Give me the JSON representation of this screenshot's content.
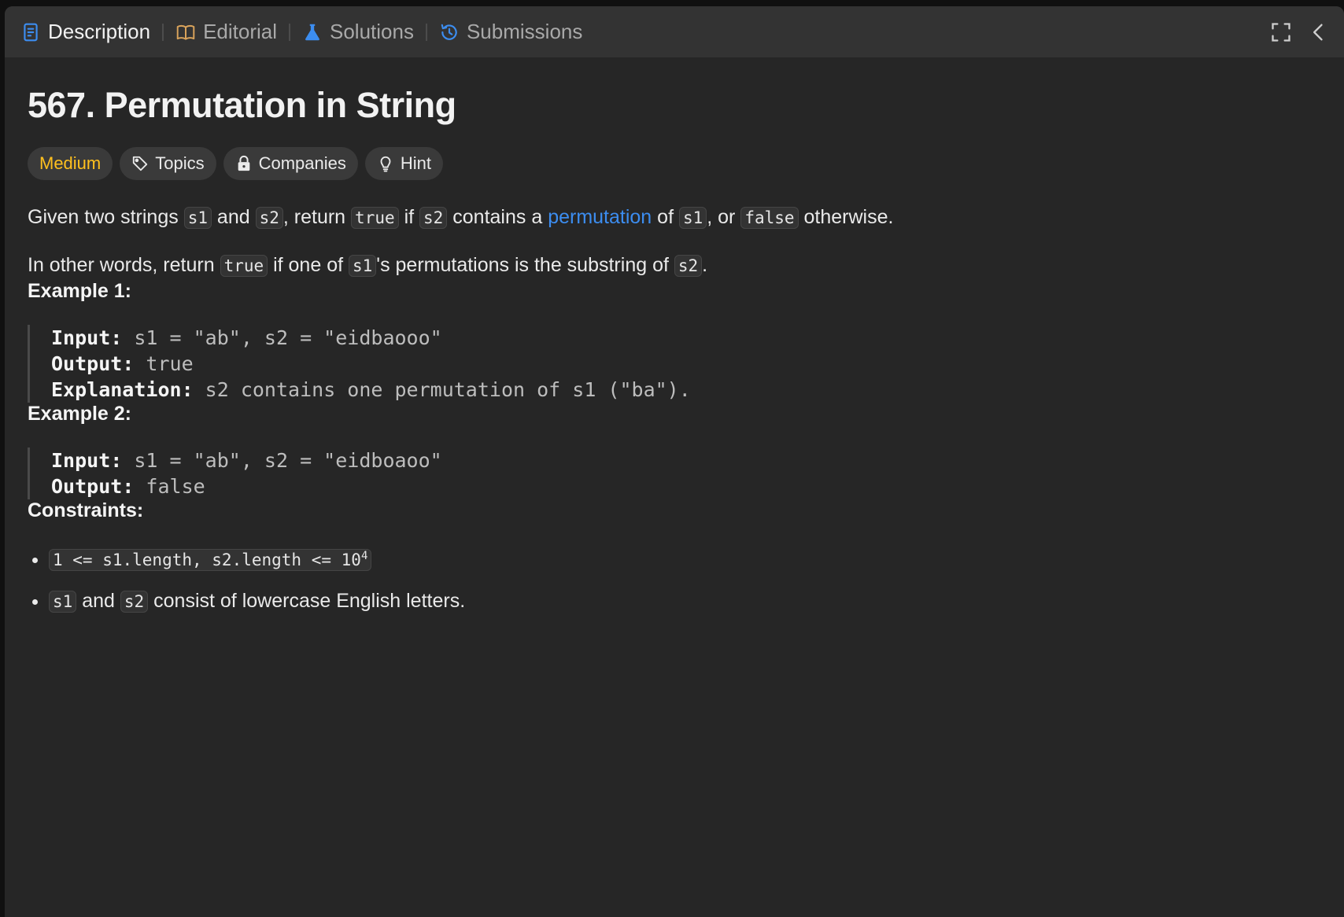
{
  "tabs": {
    "description": "Description",
    "editorial": "Editorial",
    "solutions": "Solutions",
    "submissions": "Submissions"
  },
  "problem": {
    "title": "567. Permutation in String",
    "tags": {
      "difficulty": "Medium",
      "topics": "Topics",
      "companies": "Companies",
      "hint": "Hint"
    }
  },
  "statement": {
    "p1": {
      "t1": "Given two strings ",
      "c1": "s1",
      "t2": " and ",
      "c2": "s2",
      "t3": ", return ",
      "c3": "true",
      "t4": " if ",
      "c4": "s2",
      "t5": " contains a ",
      "link": "permutation",
      "t6": " of ",
      "c5": "s1",
      "t7": ", or ",
      "c6": "false",
      "t8": " otherwise."
    },
    "p2": {
      "t1": "In other words, return ",
      "c1": "true",
      "t2": " if one of ",
      "c2": "s1",
      "t3": "'s permutations is the substring of ",
      "c3": "s2",
      "t4": "."
    }
  },
  "examples": [
    {
      "heading": "Example 1:",
      "input_label": "Input:",
      "input_value": " s1 = \"ab\", s2 = \"eidbaooo\"",
      "output_label": "Output:",
      "output_value": " true",
      "explanation_label": "Explanation:",
      "explanation_value": " s2 contains one permutation of s1 (\"ba\")."
    },
    {
      "heading": "Example 2:",
      "input_label": "Input:",
      "input_value": " s1 = \"ab\", s2 = \"eidboaoo\"",
      "output_label": "Output:",
      "output_value": " false"
    }
  ],
  "constraints": {
    "heading": "Constraints:",
    "c1_code": "1 <= s1.length, s2.length <= 10",
    "c1_exp": "4",
    "c2_code1": "s1",
    "c2_t1": " and ",
    "c2_code2": "s2",
    "c2_t2": " consist of lowercase English letters."
  },
  "icons": {
    "description": "document-icon",
    "editorial": "book-icon",
    "solutions": "flask-icon",
    "submissions": "history-icon",
    "topics": "tag-icon",
    "companies": "lock-icon",
    "hint": "lightbulb-icon",
    "fullscreen": "fullscreen-icon",
    "collapse": "chevron-left-icon"
  },
  "colors": {
    "panel_bg": "#262626",
    "tabbar_bg": "#333333",
    "medium": "#ffc01e",
    "link": "#3c8df0",
    "active_tab_icon": "#3c8df0"
  }
}
